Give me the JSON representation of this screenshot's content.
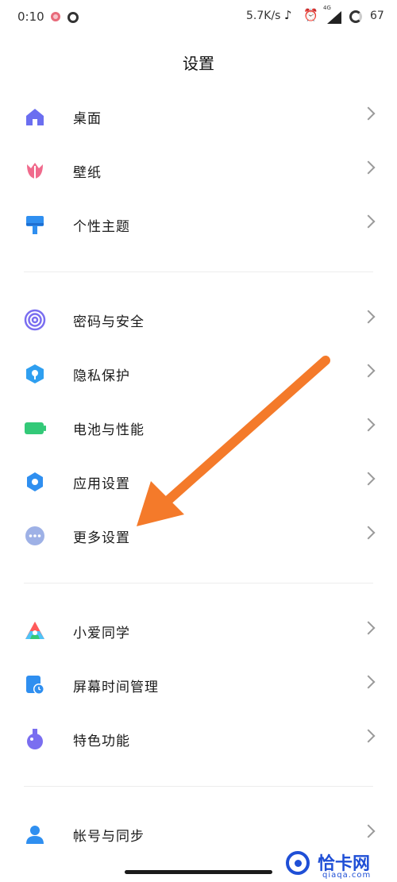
{
  "status_bar": {
    "time": "0:10",
    "net_speed": "5.7K/s",
    "network_type": "4G",
    "battery": "67"
  },
  "page": {
    "title": "设置"
  },
  "groups": [
    {
      "items": [
        {
          "label": "桌面",
          "icon": "home-icon",
          "color": "#6b6ef0"
        },
        {
          "label": "壁纸",
          "icon": "tulip-icon",
          "color": "#f06a8c"
        },
        {
          "label": "个性主题",
          "icon": "paint-brush-icon",
          "color": "#2f8ff0"
        }
      ]
    },
    {
      "items": [
        {
          "label": "密码与安全",
          "icon": "fingerprint-icon",
          "color": "#7a6ef0"
        },
        {
          "label": "隐私保护",
          "icon": "privacy-shield-icon",
          "color": "#2f9ff0"
        },
        {
          "label": "电池与性能",
          "icon": "battery-icon",
          "color": "#33c978"
        },
        {
          "label": "应用设置",
          "icon": "gear-icon",
          "color": "#2f8ff0"
        },
        {
          "label": "更多设置",
          "icon": "more-dots-icon",
          "color": "#9eb1e6"
        }
      ]
    },
    {
      "items": [
        {
          "label": "小爱同学",
          "icon": "xiaoai-icon",
          "color": "#ff5a5a"
        },
        {
          "label": "屏幕时间管理",
          "icon": "screen-time-icon",
          "color": "#2f8ff0"
        },
        {
          "label": "特色功能",
          "icon": "flask-icon",
          "color": "#7a6ef0"
        }
      ]
    },
    {
      "items": [
        {
          "label": "帐号与同步",
          "icon": "person-icon",
          "color": "#2f8ff0"
        }
      ]
    }
  ],
  "watermark": {
    "text": "恰卡网",
    "sub": "qiaqa.com",
    "color": "#1f4fd6"
  },
  "annotation_arrow": {
    "color": "#f47a2a"
  }
}
